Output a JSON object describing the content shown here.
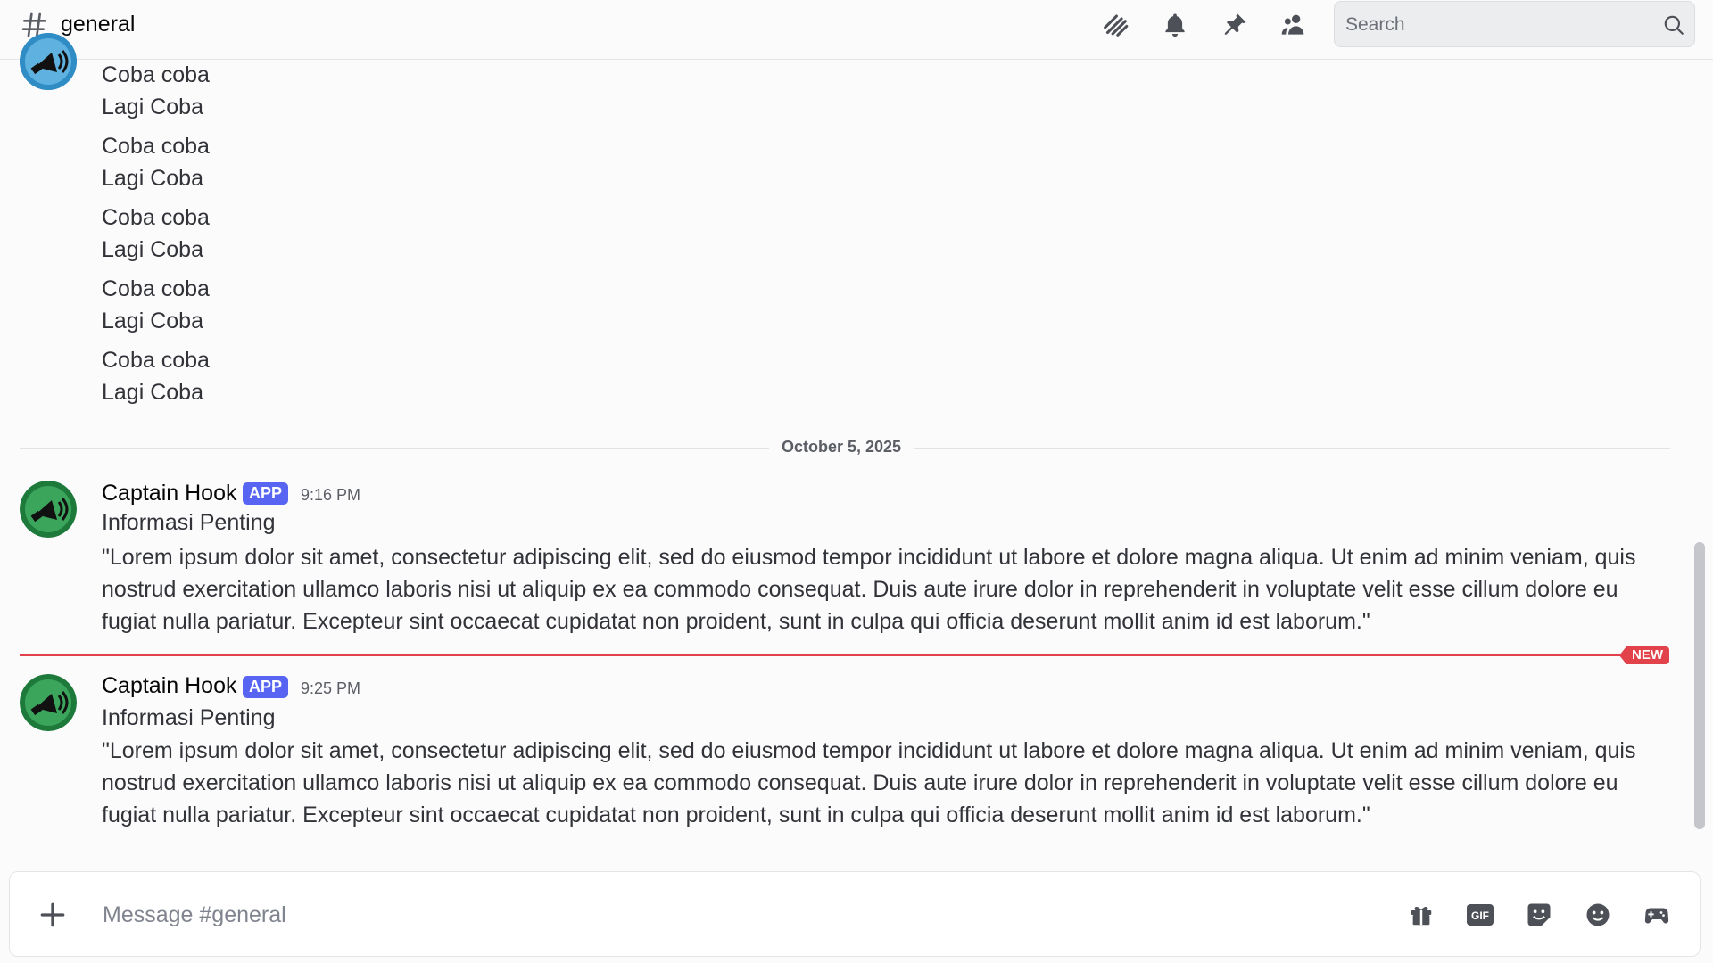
{
  "header": {
    "channel_name": "general",
    "search_placeholder": "Search",
    "icons": [
      "threads-icon",
      "notification-bell-icon",
      "pin-icon",
      "member-list-icon",
      "search-icon"
    ]
  },
  "earlier_messages": [
    {
      "line1": "Coba coba",
      "line2": "Lagi Coba"
    },
    {
      "line1": "Coba coba",
      "line2": "Lagi Coba"
    },
    {
      "line1": "Coba coba",
      "line2": "Lagi Coba"
    },
    {
      "line1": "Coba coba",
      "line2": "Lagi Coba"
    },
    {
      "line1": "Coba coba",
      "line2": "Lagi Coba"
    }
  ],
  "date_divider": "October 5, 2025",
  "messages": [
    {
      "author": "Captain Hook",
      "badge": "APP",
      "time": "9:16 PM",
      "title": "Informasi Penting",
      "body": "\"Lorem ipsum dolor sit amet, consectetur adipiscing elit, sed do eiusmod tempor incididunt ut labore et dolore magna aliqua. Ut enim ad minim veniam, quis nostrud exercitation ullamco laboris nisi ut aliquip ex ea commodo consequat. Duis aute irure dolor in reprehenderit in voluptate velit esse cillum dolore eu fugiat nulla pariatur. Excepteur sint occaecat cupidatat non proident, sunt in culpa qui officia deserunt mollit anim id est laborum.\""
    },
    {
      "author": "Captain Hook",
      "badge": "APP",
      "time": "9:25 PM",
      "title": "Informasi Penting",
      "body": "\"Lorem ipsum dolor sit amet, consectetur adipiscing elit, sed do eiusmod tempor incididunt ut labore et dolore magna aliqua. Ut enim ad minim veniam, quis nostrud exercitation ullamco laboris nisi ut aliquip ex ea commodo consequat. Duis aute irure dolor in reprehenderit in voluptate velit esse cillum dolore eu fugiat nulla pariatur. Excepteur sint occaecat cupidatat non proident, sunt in culpa qui officia deserunt mollit anim id est laborum.\""
    }
  ],
  "new_marker": "NEW",
  "composer": {
    "placeholder": "Message #general",
    "icons": [
      "add-attachment-icon",
      "gift-icon",
      "gif-icon",
      "sticker-icon",
      "emoji-icon",
      "activities-icon"
    ],
    "gif_label": "GIF"
  },
  "colors": {
    "accent": "#5865f2",
    "new_marker": "#e2424a",
    "avatar_green": "#3ba55c",
    "avatar_blue": "#2f8cc4"
  }
}
